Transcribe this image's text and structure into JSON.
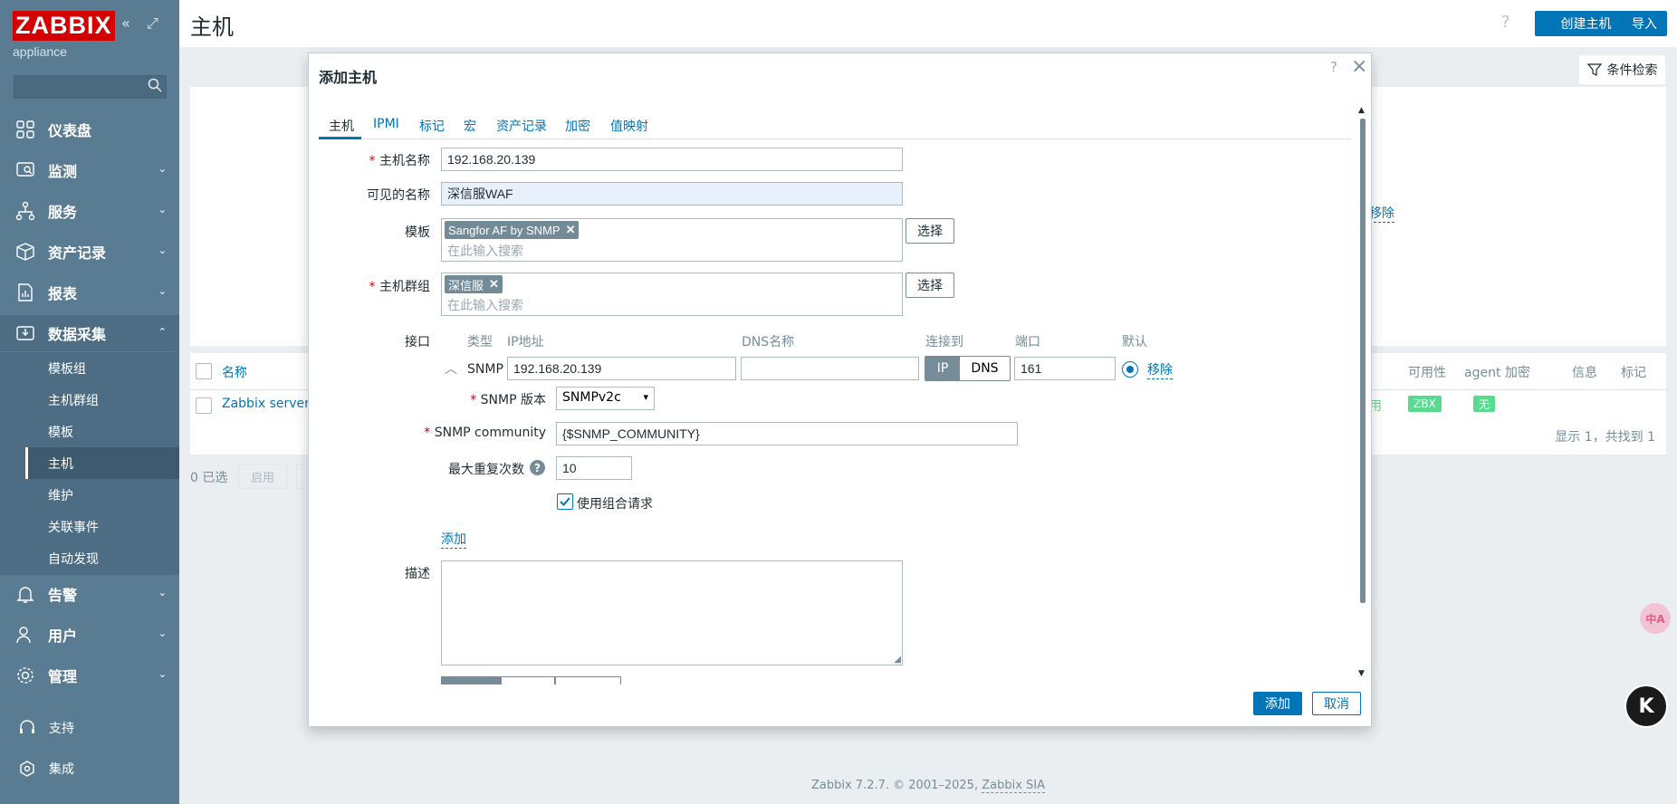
{
  "app": {
    "logo": "ZABBIX",
    "subtitle": "appliance",
    "page_title": "主机",
    "help": "?",
    "create_host": "创建主机",
    "import": "导入",
    "filter": "条件检索",
    "filter_remove": "移除"
  },
  "sidebar": {
    "menu": [
      {
        "label": "仪表盘",
        "icon": "dashboard-icon"
      },
      {
        "label": "监测",
        "icon": "monitoring-icon"
      },
      {
        "label": "服务",
        "icon": "services-icon"
      },
      {
        "label": "资产记录",
        "icon": "inventory-icon"
      },
      {
        "label": "报表",
        "icon": "reports-icon"
      },
      {
        "label": "数据采集",
        "icon": "data-collection-icon"
      },
      {
        "label": "告警",
        "icon": "alerts-icon"
      },
      {
        "label": "用户",
        "icon": "users-icon"
      },
      {
        "label": "管理",
        "icon": "administration-icon"
      }
    ],
    "submenu": [
      "模板组",
      "主机群组",
      "模板",
      "主机",
      "维护",
      "关联事件",
      "自动发现"
    ],
    "bottom": [
      {
        "label": "支持",
        "icon": "support-icon"
      },
      {
        "label": "集成",
        "icon": "integrations-icon"
      }
    ]
  },
  "list": {
    "columns": {
      "name": "名称",
      "availability": "可用性",
      "agent_encryption": "agent 加密",
      "info": "信息",
      "tags": "标记"
    },
    "row": {
      "name": "Zabbix server",
      "availability": "ZBX",
      "encryption": "无",
      "partial": "用"
    },
    "displaying": "显示 1，共找到 1",
    "selected": "0 已选",
    "enable_btn": "启用"
  },
  "footer": {
    "text": "Zabbix 7.2.7. © 2001–2025, ",
    "link": "Zabbix SIA"
  },
  "modal": {
    "title": "添加主机",
    "help": "?",
    "tabs": [
      "主机",
      "IPMI",
      "标记",
      "宏",
      "资产记录",
      "加密",
      "值映射"
    ],
    "host_name_label": "主机名称",
    "host_name": "192.168.20.139",
    "visible_name_label": "可见的名称",
    "visible_name": "深信服WAF",
    "templates_label": "模板",
    "template_tag": "Sangfor AF by SNMP",
    "search_placeholder": "在此输入搜索",
    "select": "选择",
    "host_groups_label": "主机群组",
    "group_tag": "深信服",
    "interfaces_label": "接口",
    "iface_cols": {
      "type": "类型",
      "ip": "IP地址",
      "dns": "DNS名称",
      "connect": "连接到",
      "port": "端口",
      "default": "默认"
    },
    "iface": {
      "type": "SNMP",
      "ip": "192.168.20.139",
      "dns": "",
      "connect_ip": "IP",
      "connect_dns": "DNS",
      "port": "161",
      "remove": "移除"
    },
    "snmp_version_label": "SNMP 版本",
    "snmp_version": "SNMPv2c",
    "snmp_community_label": "SNMP community",
    "snmp_community": "{$SNMP_COMMUNITY}",
    "max_repetitions_label": "最大重复次数",
    "max_repetitions": "10",
    "bulk_label": "使用组合请求",
    "add_link": "添加",
    "description_label": "描述",
    "add_button": "添加",
    "cancel_button": "取消"
  },
  "colors": {
    "sidebar": "#5a7c93",
    "primary": "#0275b8",
    "logo": "#d40000",
    "available": "#59db8f"
  }
}
